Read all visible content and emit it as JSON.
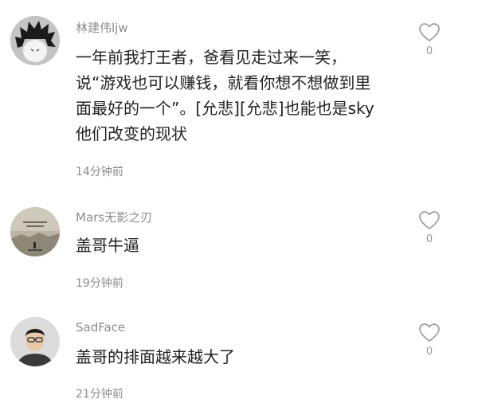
{
  "comments": [
    {
      "username": "林建伟ljw",
      "text": "一年前我打王者，爸看见走过来一笑，说“游戏也可以赚钱，就看你想不想做到里面最好的一个”。[允悲][允悲]也能也是sky他们改变的现状",
      "time": "14分钟前",
      "likes": "0",
      "avatar_icon": "spiky-hair-cartoon-avatar-icon"
    },
    {
      "username": "Mars无影之刃",
      "text": "盖哥牛逼",
      "time": "19分钟前",
      "likes": "0",
      "avatar_icon": "landscape-photo-avatar-icon"
    },
    {
      "username": "SadFace",
      "text": "盖哥的排面越来越大了",
      "time": "21分钟前",
      "likes": "0",
      "avatar_icon": "person-photo-avatar-icon"
    }
  ],
  "icons": {
    "like": "heart-icon"
  },
  "colors": {
    "username": "#8c8c8c",
    "text": "#222222",
    "time": "#8c8c8c",
    "like_icon": "#a0a0a0"
  }
}
